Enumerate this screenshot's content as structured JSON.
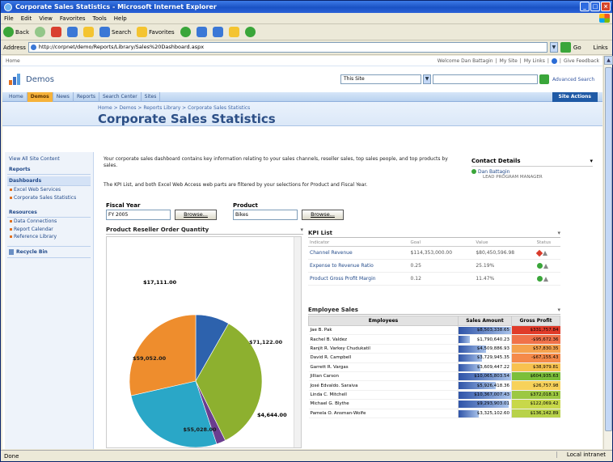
{
  "window": {
    "title": "Corporate Sales Statistics - Microsoft Internet Explorer"
  },
  "menu": [
    "File",
    "Edit",
    "View",
    "Favorites",
    "Tools",
    "Help"
  ],
  "toolbar": {
    "back": "Back",
    "search": "Search",
    "favorites": "Favorites"
  },
  "address": {
    "label": "Address",
    "url": "http://corpnet/demo/Reports/Library/Sales%20Dashboard.aspx",
    "go": "Go",
    "links": "Links"
  },
  "status": {
    "left": "Done",
    "zone": "Local intranet"
  },
  "sp": {
    "home_link": "Home",
    "welcome": "Welcome Dan Battagin",
    "my_site": "My Site",
    "my_links": "My Links",
    "feedback": "Give Feedback",
    "site_name": "Demos",
    "search_scope": "This Site",
    "advanced_search": "Advanced Search",
    "site_actions": "Site Actions"
  },
  "topnav": [
    "Home",
    "Demos",
    "News",
    "Reports",
    "Search Center",
    "Sites"
  ],
  "breadcrumb": "Home > Demos > Reports Library > Corporate Sales Statistics",
  "page_title": "Corporate Sales Statistics",
  "leftnav": {
    "view_all": "View All Site Content",
    "reports": "Reports",
    "dashboards": "Dashboards",
    "dash_items": [
      "Excel Web Services",
      "Corporate Sales Statistics"
    ],
    "resources": "Resources",
    "res_items": [
      "Data Connections",
      "Report Calendar",
      "Reference Library"
    ],
    "recycle": "Recycle Bin"
  },
  "intro": "Your corporate sales dashboard contains key information relating to your sales channels, reseller sales, top sales people, and top products by sales.",
  "intro2": "The KPI List, and both Excel Web Access web parts are filtered by your selections for Product and Fiscal Year.",
  "contact": {
    "title": "Contact Details",
    "name": "Dan Battagin",
    "role": "LEAD PROGRAM MANAGER"
  },
  "filters": {
    "fiscal_label": "Fiscal Year",
    "fiscal_value": "FY 2005",
    "product_label": "Product",
    "product_value": "Bikes",
    "browse": "Browse..."
  },
  "chart": {
    "title": "Product Reseller Order Quantity"
  },
  "chart_data": {
    "type": "pie",
    "values": [
      17111,
      71122,
      4644,
      55028,
      59052
    ],
    "labels": [
      "$17,111.00",
      "$71,122.00",
      "$4,644.00",
      "$55,028.00",
      "$59,052.00"
    ],
    "colors": [
      "#2d62ad",
      "#8db02f",
      "#6a3d8f",
      "#2aa7c7",
      "#ee8d2d"
    ]
  },
  "kpi": {
    "title": "KPI List",
    "headers": [
      "Indicator",
      "Goal",
      "Value",
      "Status"
    ],
    "rows": [
      {
        "indicator": "Channel Revenue",
        "goal": "$114,353,000.00",
        "value": "$80,450,596.98",
        "status": "red"
      },
      {
        "indicator": "Expense to Revenue Ratio",
        "goal": "0.25",
        "value": "25.19%",
        "status": "green"
      },
      {
        "indicator": "Product Gross Profit Margin",
        "goal": "0.12",
        "value": "11.47%",
        "status": "green"
      }
    ]
  },
  "employee": {
    "title": "Employee Sales",
    "headers": [
      "Employees",
      "Sales Amount",
      "Gross Profit"
    ],
    "rows": [
      {
        "name": "Jae B. Pak",
        "sales": "$8,503,338.65",
        "bar": 1.0,
        "profit": "$331,757.84",
        "color": "#e03b2a"
      },
      {
        "name": "Rachel B. Valdez",
        "sales": "$1,790,640.23",
        "bar": 0.21,
        "profit": "-$95,672.36",
        "color": "#f0724a"
      },
      {
        "name": "Ranjit R. Varkey Chudukatil",
        "sales": "$4,509,886.93",
        "bar": 0.53,
        "profit": "$57,830.35",
        "color": "#f5a24d"
      },
      {
        "name": "David R. Campbell",
        "sales": "$3,729,945.35",
        "bar": 0.44,
        "profit": "-$67,155.43",
        "color": "#f58a4a"
      },
      {
        "name": "Garrett R. Vargas",
        "sales": "$3,609,447.22",
        "bar": 0.42,
        "profit": "$38,979.81",
        "color": "#f8c24f"
      },
      {
        "name": "Jillian Carson",
        "sales": "$10,065,803.54",
        "bar": 1.0,
        "profit": "$604,935.63",
        "color": "#7bbf3a"
      },
      {
        "name": "José Edvaldo. Saraiva",
        "sales": "$5,926,418.36",
        "bar": 0.7,
        "profit": "$26,757.98",
        "color": "#f7d25a"
      },
      {
        "name": "Linda C. Mitchell",
        "sales": "$10,367,007.43",
        "bar": 1.0,
        "profit": "$372,018.13",
        "color": "#9cc842"
      },
      {
        "name": "Michael G. Blythe",
        "sales": "$9,293,903.01",
        "bar": 0.95,
        "profit": "$122,069.42",
        "color": "#c8d84a"
      },
      {
        "name": "Pamela O. Ansman-Wolfe",
        "sales": "$3,325,102.60",
        "bar": 0.39,
        "profit": "$136,142.89",
        "color": "#b8d24a"
      }
    ]
  }
}
